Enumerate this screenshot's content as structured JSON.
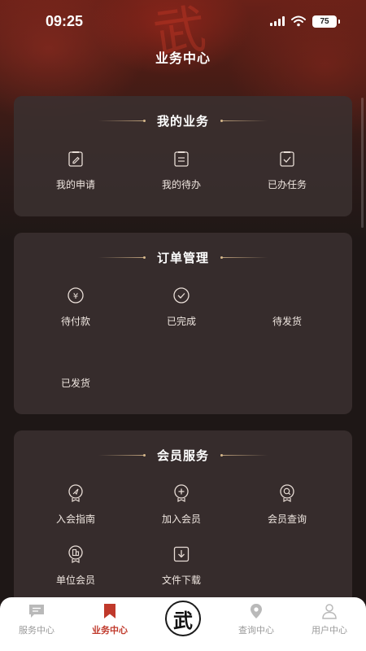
{
  "status": {
    "time": "09:25",
    "battery": "75"
  },
  "header": {
    "title": "业务中心",
    "hero_mark": "武"
  },
  "sections": [
    {
      "title": "我的业务",
      "items": [
        {
          "label": "我的申请",
          "icon": "edit-doc-icon"
        },
        {
          "label": "我的待办",
          "icon": "list-doc-icon"
        },
        {
          "label": "已办任务",
          "icon": "check-doc-icon"
        }
      ]
    },
    {
      "title": "订单管理",
      "items": [
        {
          "label": "待付款",
          "icon": "yuan-circle-icon"
        },
        {
          "label": "已完成",
          "icon": "check-circle-icon"
        },
        {
          "label": "待发货",
          "icon": ""
        },
        {
          "label": "已发货",
          "icon": ""
        }
      ]
    },
    {
      "title": "会员服务",
      "items": [
        {
          "label": "入会指南",
          "icon": "guide-badge-icon"
        },
        {
          "label": "加入会员",
          "icon": "add-badge-icon"
        },
        {
          "label": "会员查询",
          "icon": "search-badge-icon"
        },
        {
          "label": "单位会员",
          "icon": "building-badge-icon"
        },
        {
          "label": "文件下载",
          "icon": "download-icon"
        }
      ]
    }
  ],
  "tabbar": {
    "items": [
      {
        "label": "服务中心",
        "icon": "chat-icon"
      },
      {
        "label": "业务中心",
        "icon": "bookmark-icon",
        "active": true
      },
      {
        "label": "查询中心",
        "icon": "location-icon"
      },
      {
        "label": "用户中心",
        "icon": "user-icon"
      }
    ],
    "center_logo": "武"
  },
  "colors": {
    "accent": "#c0392b",
    "card": "#3a3030",
    "background": "#1e1716"
  }
}
